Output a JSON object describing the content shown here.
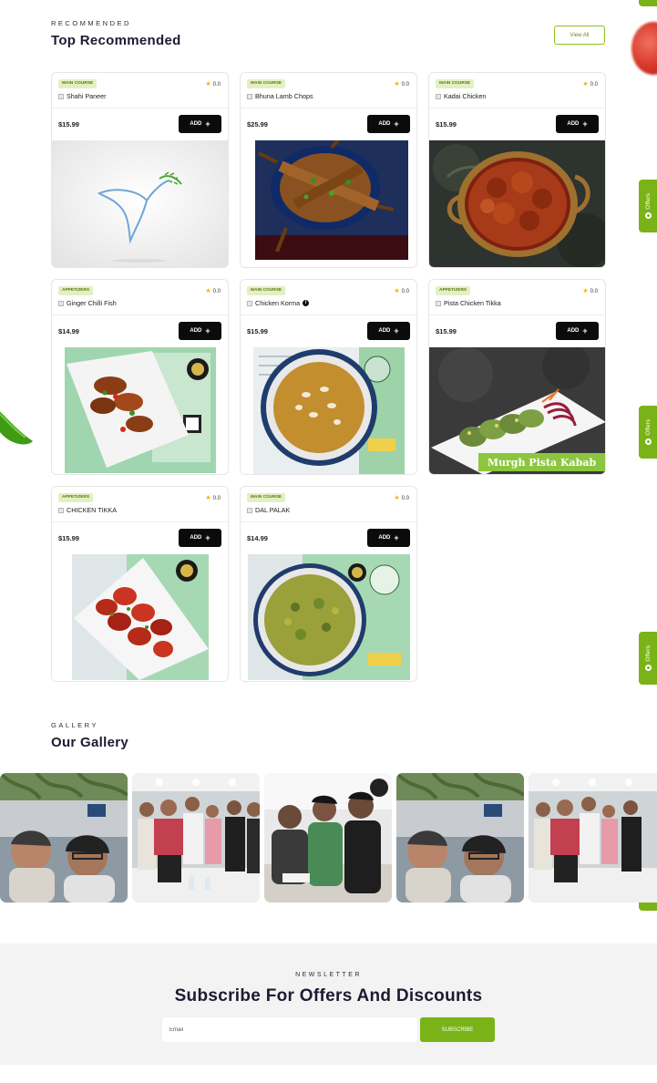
{
  "recommended": {
    "eyebrow": "RECOMMENDED",
    "title": "Top Recommended",
    "view_all_label": "View All"
  },
  "products": [
    {
      "category": "MAIN COURSE",
      "rating": "0.0",
      "name": "Shahi Paneer",
      "price": "$15.99",
      "add_label": "ADD"
    },
    {
      "category": "MAIN COURSE",
      "rating": "0.0",
      "name": "Bhuna Lamb Chops",
      "price": "$25.99",
      "add_label": "ADD"
    },
    {
      "category": "MAIN COURSE",
      "rating": "0.0",
      "name": "Kadai Chicken",
      "price": "$15.99",
      "add_label": "ADD"
    },
    {
      "category": "APPETIZERS",
      "rating": "0.0",
      "name": "Ginger Chilli Fish",
      "price": "$14.99",
      "add_label": "ADD"
    },
    {
      "category": "MAIN COURSE",
      "rating": "0.0",
      "name": "Chicken Korma",
      "price": "$15.99",
      "add_label": "ADD",
      "info_icon": "i"
    },
    {
      "category": "APPETIZERS",
      "rating": "0.0",
      "name": "Pista Chicken Tikka",
      "price": "$15.99",
      "add_label": "ADD",
      "image_caption": "Murgh Pista Kabab"
    },
    {
      "category": "APPETIZERS",
      "rating": "0.0",
      "name": "CHICKEN TIKKA",
      "price": "$15.99",
      "add_label": "ADD"
    },
    {
      "category": "MAIN COURSE",
      "rating": "0.0",
      "name": "DAL PALAK",
      "price": "$14.99",
      "add_label": "ADD"
    }
  ],
  "gallery": {
    "eyebrow": "GALLERY",
    "title": "Our Gallery"
  },
  "offers_tab_label": "Offers",
  "newsletter": {
    "eyebrow": "NEWSLETTER",
    "title": "Subscribe For Offers And Discounts",
    "email_placeholder": "Email",
    "subscribe_label": "SUBSCRIBE"
  },
  "colors": {
    "accent_green": "#7ab317",
    "category_badge_bg": "#e4efc4",
    "add_button": "#0b0b0b",
    "star": "#f3b400"
  },
  "icons": [
    "star-icon",
    "plus-icon",
    "veg-indicator-icon",
    "info-icon",
    "offers-tag-icon"
  ]
}
